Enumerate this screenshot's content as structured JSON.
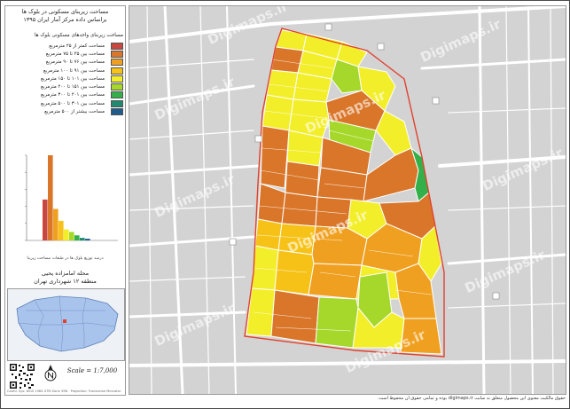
{
  "panel": {
    "title_line1": "مساحت زیربنای مسکونی در بلوک ها",
    "title_line2": "براساس داده مرکز آمار ایران ۱۳۹۵"
  },
  "legend": {
    "title": "مساحت زیربنای واحدهای مسکونی بلوک ها",
    "items": [
      {
        "label": "مساحت کمتر از ۲۵ مترمربع",
        "color": "#c8483f"
      },
      {
        "label": "مساحت بین ۲۵ تا ۷۵ مترمربع",
        "color": "#d9762a"
      },
      {
        "label": "مساحت بین ۷۶ تا ۹۰ مترمربع",
        "color": "#f0a020"
      },
      {
        "label": "مساحت بین ۹۱ تا ۱۰۰ مترمربع",
        "color": "#f6c218"
      },
      {
        "label": "مساحت بین ۱۰۱ تا ۱۵۰ مترمربع",
        "color": "#f3ee2a"
      },
      {
        "label": "مساحت بین ۱۵۱ تا ۲۰۰ مترمربع",
        "color": "#a5d82a"
      },
      {
        "label": "مساحت بین ۲۰۱ تا ۳۰۰ مترمربع",
        "color": "#33b04a"
      },
      {
        "label": "مساحت بین ۳۰۱ تا ۵۰۰ مترمربع",
        "color": "#1f8a70"
      },
      {
        "label": "مساحت بیشتر از ۵۰۰ مترمربع",
        "color": "#1d5c8c"
      }
    ]
  },
  "chart_data": {
    "type": "bar",
    "categories": [
      "<25",
      "25-75",
      "76-90",
      "91-100",
      "101-150",
      "151-200",
      "201-300",
      "301-500",
      ">500"
    ],
    "values": [
      48,
      100,
      37,
      23,
      13,
      10,
      6,
      3,
      2
    ],
    "colors": [
      "#c8483f",
      "#d9762a",
      "#f0a020",
      "#f6c218",
      "#f3ee2a",
      "#a5d82a",
      "#33b04a",
      "#1f8a70",
      "#1d5c8c"
    ],
    "y_tick_labels": [
      "",
      "",
      "",
      "",
      "",
      ""
    ],
    "title": "",
    "xlabel": "",
    "ylabel": ""
  },
  "chart_note": "درصد توزیع بلوک ها در طبقات مساحت زیربنا",
  "location": {
    "line1": "محله امامزاده یحیی",
    "line2": "منطقه ۱۲ شهرداری تهران"
  },
  "scale_text": "Scale = 1:7,000",
  "credit": "Coord. Sys: WGS 1984 UTM Zone 39N · Projection: Transverse Mercator",
  "footer": "حقوق مالکیت معنوی این محصول متعلق به سایت digimaps.ir بوده و تمامی حقوق آن محفوظ است.",
  "watermarks": [
    "Digimaps.ir",
    "Digimaps.ir",
    "Digimaps.ir",
    "Digimaps.ir",
    "Digimaps.ir",
    "Digimaps.ir",
    "Digimaps.ir",
    "Digimaps.ir",
    "Digimaps.ir",
    "Digimaps.ir"
  ],
  "colors": {
    "map_bg": "#d3d3d3",
    "boundary": "#e0412c",
    "road": "#ffffff"
  }
}
